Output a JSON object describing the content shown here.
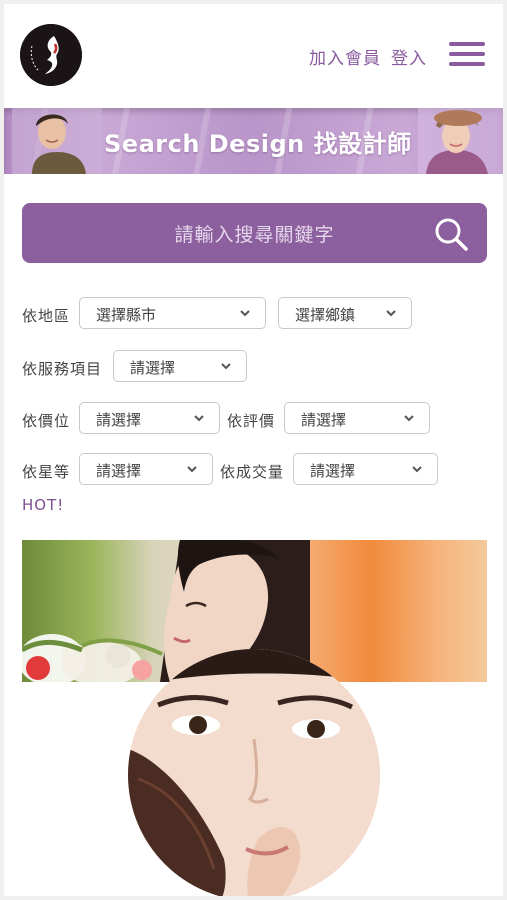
{
  "header": {
    "logo_icon": "salon-logo-icon",
    "join_label": "加入會員",
    "login_label": "登入",
    "menu_icon": "hamburger-menu-icon",
    "accent_color": "#8a5a9e"
  },
  "banner": {
    "title": "Search Design 找設計師"
  },
  "search": {
    "placeholder": "請輸入搜尋關鍵字",
    "icon": "search-icon",
    "bg_color": "#8c5f9e"
  },
  "filters": {
    "region": {
      "label": "依地區",
      "city": "選擇縣市",
      "town": "選擇鄉鎮"
    },
    "service": {
      "label": "依服務項目",
      "value": "請選擇"
    },
    "price": {
      "label": "依價位",
      "value": "請選擇"
    },
    "rating": {
      "label": "依評價",
      "value": "請選擇"
    },
    "stars": {
      "label": "依星等",
      "value": "請選擇"
    },
    "deals": {
      "label": "依成交量",
      "value": "請選擇"
    }
  },
  "hot_label": "HOT!"
}
